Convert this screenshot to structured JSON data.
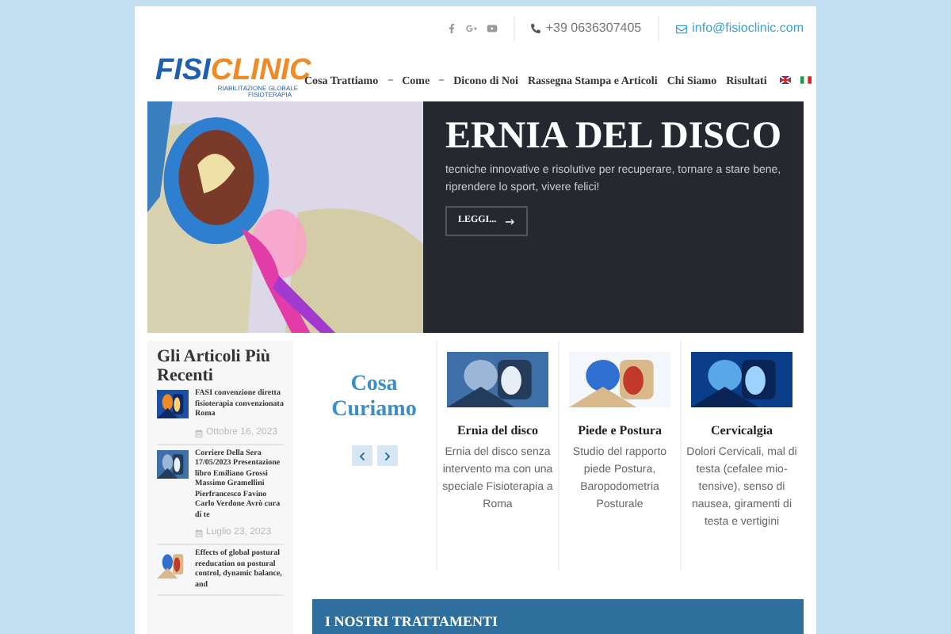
{
  "logo": {
    "text_left": "FISI",
    "text_right": "CLINIC",
    "tagline": "RIABILITAZIONE GLOBALE",
    "tagline_2": "FISIOTERAPIA"
  },
  "contact": {
    "phone": "+39 0636307405",
    "email": "info@fisioclinic.com"
  },
  "nav": [
    {
      "label": "Cosa Trattiamo",
      "dropdown": true
    },
    {
      "label": "Come",
      "dropdown": true
    },
    {
      "label": "Dicono di Noi",
      "dropdown": false
    },
    {
      "label": "Rassegna Stampa e Articoli",
      "dropdown": false
    },
    {
      "label": "Chi Siamo",
      "dropdown": false
    },
    {
      "label": "Risultati",
      "dropdown": false
    }
  ],
  "hero": {
    "title": "ERNIA DEL DISCO",
    "text": "tecniche innovative e risolutive per recuperare, tornare a stare bene, riprendere lo sport, vivere felici!",
    "button": "LEGGI..."
  },
  "sidebar": {
    "title": "Gli Articoli Più Recenti",
    "articles": [
      {
        "title": "FASI convenzione diretta fisioterapia convenzionata Roma",
        "date": "Ottobre 16, 2023"
      },
      {
        "title": "Corriere Della Sera 17/05/2023 Presentazione libro Emiliano Grossi Massimo Gramellini Pierfrancesco Favino Carlo Verdone Avrò cura di te",
        "date": "Luglio 23, 2023"
      },
      {
        "title": "Effects of global postural reeducation on postural control, dynamic balance, and"
      }
    ]
  },
  "section": {
    "title": "Cosa Curiamo",
    "cards": [
      {
        "title": "Ernia del disco",
        "text": "Ernia del disco senza intervento ma con una speciale Fisioterapia a Roma"
      },
      {
        "title": "Piede e Postura",
        "text": "Studio del rapporto piede Postura, Baropodometria Posturale"
      },
      {
        "title": "Cervicalgia",
        "text": "Dolori Cervicali, mal di testa (cefalee mio-tensive), senso di nausea, giramenti di testa e vertigini"
      }
    ],
    "banner": "I NOSTRI TRATTAMENTI"
  }
}
